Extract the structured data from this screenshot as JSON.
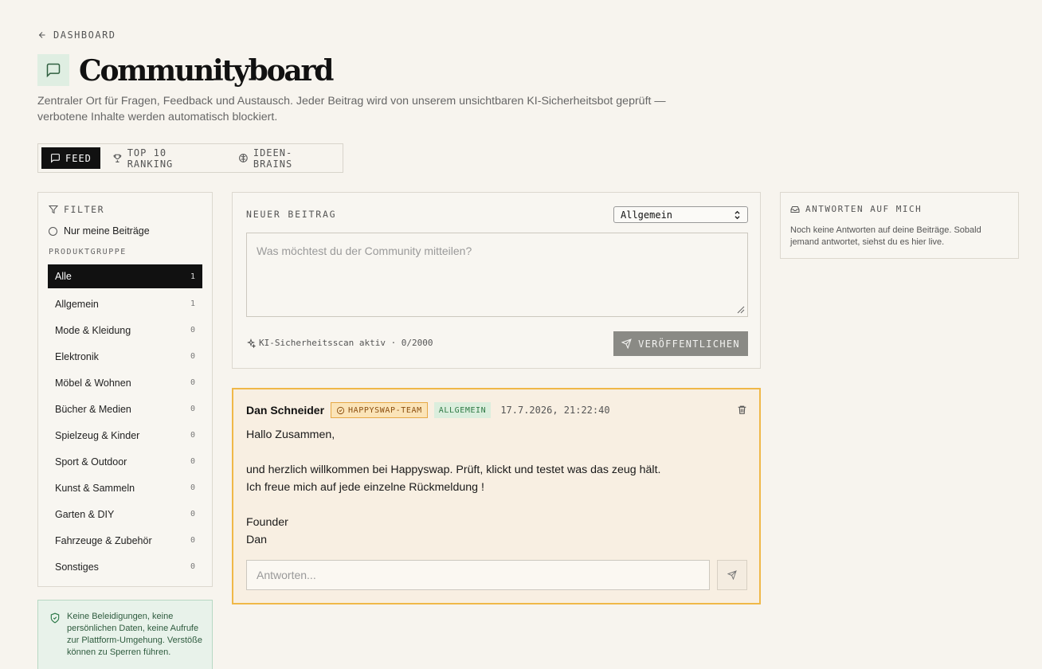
{
  "nav": {
    "back_label": "DASHBOARD"
  },
  "header": {
    "title": "Communityboard",
    "subtitle": "Zentraler Ort für Fragen, Feedback und Austausch. Jeder Beitrag wird von unserem unsichtbaren KI-Sicherheitsbot geprüft — verbotene Inhalte werden automatisch blockiert."
  },
  "tabs": [
    {
      "label": "FEED",
      "icon": "message-square-icon",
      "active": true
    },
    {
      "label": "TOP 10 RANKING",
      "icon": "trophy-icon",
      "active": false
    },
    {
      "label": "IDEEN-BRAINS",
      "icon": "brain-icon",
      "active": false
    }
  ],
  "filter": {
    "title": "FILTER",
    "only_mine_label": "Nur meine Beiträge",
    "group_label": "PRODUKTGRUPPE",
    "categories": [
      {
        "name": "Alle",
        "count": "1",
        "active": true
      },
      {
        "name": "Allgemein",
        "count": "1"
      },
      {
        "name": "Mode & Kleidung",
        "count": "0"
      },
      {
        "name": "Elektronik",
        "count": "0"
      },
      {
        "name": "Möbel & Wohnen",
        "count": "0"
      },
      {
        "name": "Bücher & Medien",
        "count": "0"
      },
      {
        "name": "Spielzeug & Kinder",
        "count": "0"
      },
      {
        "name": "Sport & Outdoor",
        "count": "0"
      },
      {
        "name": "Kunst & Sammeln",
        "count": "0"
      },
      {
        "name": "Garten & DIY",
        "count": "0"
      },
      {
        "name": "Fahrzeuge & Zubehör",
        "count": "0"
      },
      {
        "name": "Sonstiges",
        "count": "0"
      }
    ]
  },
  "safety_note": "Keine Beleidigungen, keine persönlichen Daten, keine Aufrufe zur Plattform-Umgehung. Verstöße können zu Sperren führen.",
  "composer": {
    "label": "NEUER BEITRAG",
    "selected_category": "Allgemein",
    "placeholder": "Was möchtest du der Community mitteilen?",
    "scan_status": "KI-Sicherheitsscan aktiv · 0/2000",
    "publish_label": "VERÖFFENTLICHEN"
  },
  "post": {
    "author": "Dan Schneider",
    "team_badge": "HAPPYSWAP-TEAM",
    "category_badge": "ALLGEMEIN",
    "date": "17.7.2026, 21:22:40",
    "body_lines": [
      "Hallo Zusammen,",
      "",
      "und herzlich willkommen bei Happyswap. Prüft, klickt und testet was das zeug hält.",
      "Ich freue mich auf jede einzelne Rückmeldung !",
      "",
      "Founder",
      "Dan"
    ],
    "reply_placeholder": "Antworten..."
  },
  "replies_panel": {
    "title": "ANTWORTEN AUF MICH",
    "empty_text": "Noch keine Antworten auf deine Beiträge. Sobald jemand antwortet, siehst du es hier live."
  },
  "colors": {
    "background": "#f7f4ee",
    "accent_dark": "#111111",
    "post_border": "#f0b848",
    "post_bg": "#f8efe2",
    "safe_green": "#2e5b3e"
  }
}
